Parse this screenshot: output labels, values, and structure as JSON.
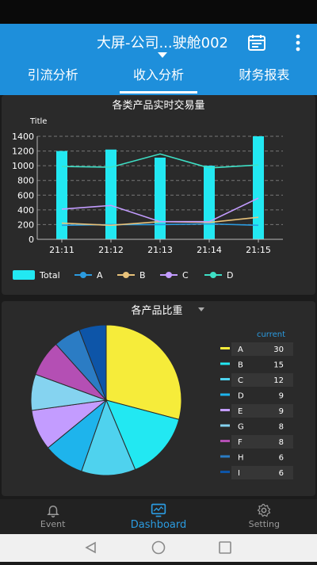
{
  "header": {
    "title": "大屏-公司...驶舱002",
    "icons": {
      "calendar": "calendar-icon",
      "more": "more-vertical-icon"
    },
    "accent": "#1e8fdb"
  },
  "tabs": [
    {
      "label": "引流分析",
      "active": false
    },
    {
      "label": "收入分析",
      "active": true
    },
    {
      "label": "财务报表",
      "active": false
    }
  ],
  "chart_data": [
    {
      "type": "bar",
      "title": "各类产品实时交易量",
      "ylabel": "Title",
      "categories": [
        "21:11",
        "21:12",
        "21:13",
        "21:14",
        "21:15"
      ],
      "ylim": [
        0,
        1400
      ],
      "yticks": [
        0,
        200,
        400,
        600,
        800,
        1000,
        1200,
        1400
      ],
      "grid": true,
      "legend_position": "bottom",
      "series": [
        {
          "name": "Total",
          "kind": "bar",
          "color": "#22e8f2",
          "values": [
            1200,
            1220,
            1110,
            1000,
            1400
          ]
        },
        {
          "name": "A",
          "kind": "line",
          "color": "#2b9be0",
          "values": [
            190,
            200,
            200,
            210,
            190
          ]
        },
        {
          "name": "B",
          "kind": "line",
          "color": "#e8c27a",
          "values": [
            220,
            190,
            240,
            230,
            300
          ]
        },
        {
          "name": "C",
          "kind": "line",
          "color": "#c39cff",
          "values": [
            410,
            460,
            240,
            240,
            560
          ]
        },
        {
          "name": "D",
          "kind": "line",
          "color": "#3ee0c6",
          "values": [
            990,
            980,
            1160,
            970,
            1010
          ]
        }
      ]
    },
    {
      "type": "pie",
      "title": "各产品比重",
      "legend_header": "current",
      "legend_position": "right",
      "slices": [
        {
          "label": "A",
          "value": 30,
          "color": "#f6ec3a"
        },
        {
          "label": "B",
          "value": 15,
          "color": "#22e8f2"
        },
        {
          "label": "C",
          "value": 12,
          "color": "#4fd2ee"
        },
        {
          "label": "D",
          "value": 9,
          "color": "#1eb4ec"
        },
        {
          "label": "E",
          "value": 9,
          "color": "#c39cff"
        },
        {
          "label": "G",
          "value": 8,
          "color": "#85d3f0"
        },
        {
          "label": "F",
          "value": 8,
          "color": "#b44fb4"
        },
        {
          "label": "H",
          "value": 6,
          "color": "#2b7cc4"
        },
        {
          "label": "I",
          "value": 6,
          "color": "#0d55a8"
        }
      ]
    }
  ],
  "bottom_nav": [
    {
      "label": "Event",
      "icon": "bell-icon",
      "active": false
    },
    {
      "label": "Dashboard",
      "icon": "dashboard-icon",
      "active": true
    },
    {
      "label": "Setting",
      "icon": "gear-icon",
      "active": false
    }
  ],
  "system_nav": {
    "icons": [
      "back-icon",
      "home-icon",
      "recents-icon"
    ]
  }
}
